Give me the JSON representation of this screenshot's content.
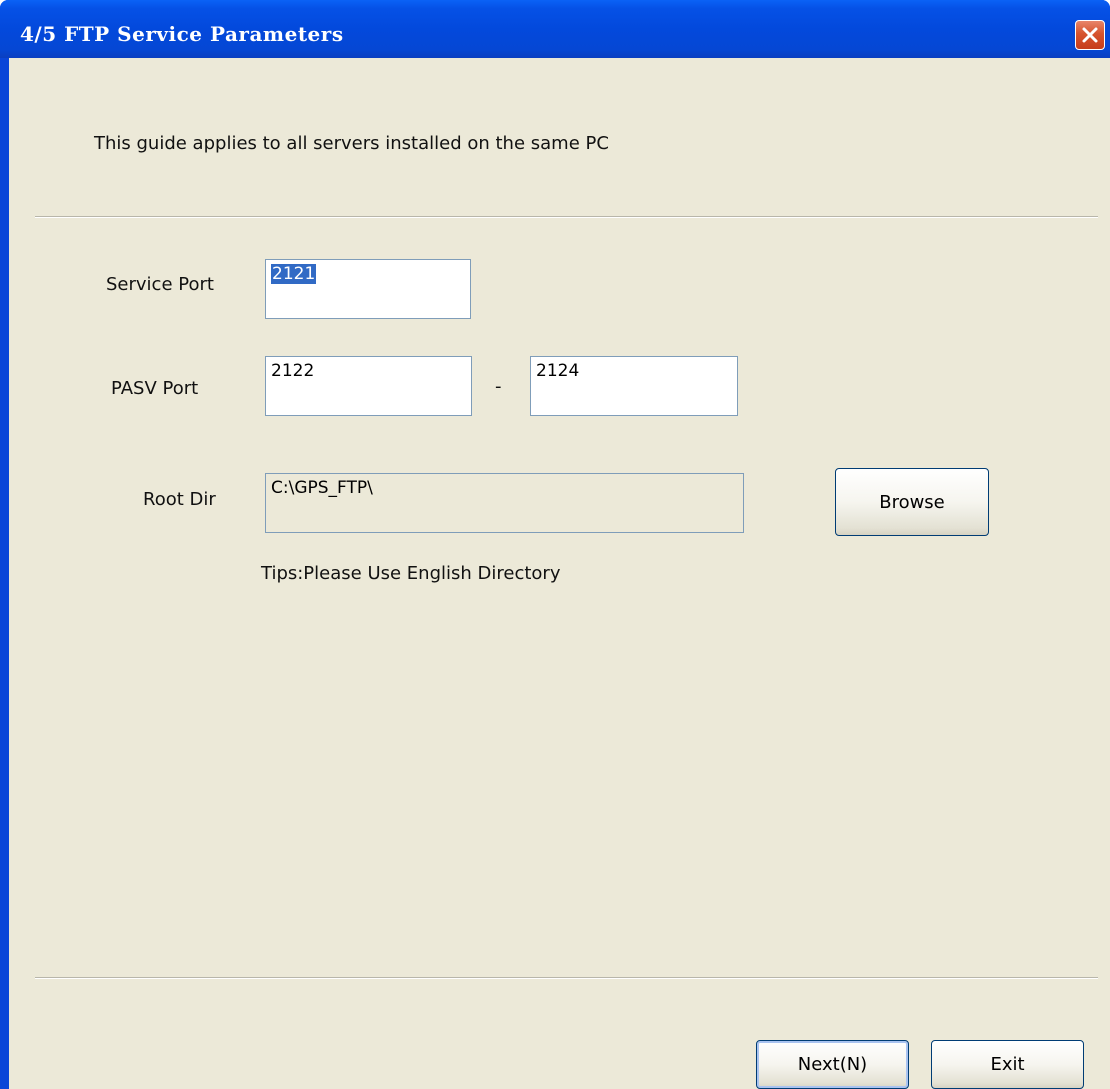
{
  "window": {
    "title": "4/5 FTP Service Parameters"
  },
  "intro_text": "This guide applies to all servers installed on the same PC",
  "service_port": {
    "label": "Service Port",
    "value": "2121"
  },
  "pasv_port": {
    "label": "PASV Port",
    "from_value": "2122",
    "separator": "-",
    "to_value": "2124"
  },
  "root_dir": {
    "label": "Root Dir",
    "value": "C:\\GPS_FTP\\",
    "browse_label": "Browse",
    "tip": "Tips:Please Use English Directory"
  },
  "footer": {
    "next_label": "Next(N)",
    "exit_label": "Exit"
  },
  "icons": {
    "close": "close-icon"
  },
  "colors": {
    "titlebar": "#0349dc",
    "client_background": "#ece9d8",
    "close_button": "#d6532e",
    "selection": "#316ac5"
  }
}
